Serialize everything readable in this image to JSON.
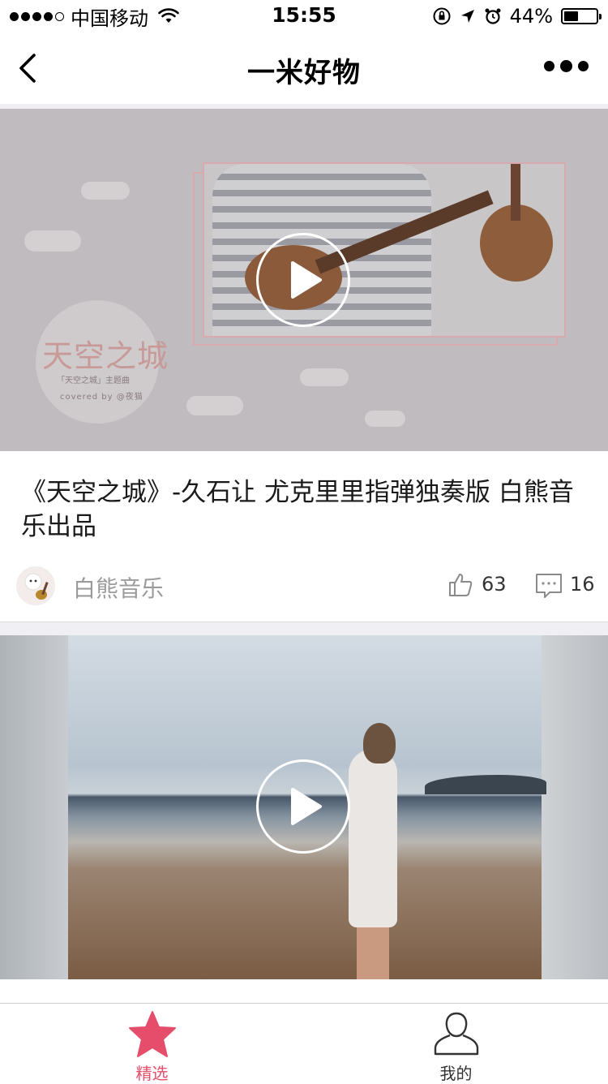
{
  "status_bar": {
    "carrier": "中国移动",
    "time": "15:55",
    "battery": "44%",
    "battery_level": 0.44
  },
  "nav": {
    "title": "一米好物",
    "back_icon": "chevron-left-icon",
    "more_icon": "more-dots-icon"
  },
  "feed": [
    {
      "title": "《天空之城》-久石让 尤克里里指弹独奏版 白熊音乐出品",
      "thumbnail_text": {
        "logo_title": "天空之城",
        "logo_sub": "「天空之城」主题曲",
        "logo_credit": "covered by @夜猫"
      },
      "author": "白熊音乐",
      "likes": "63",
      "comments": "16"
    },
    {
      "title": "",
      "author": ""
    }
  ],
  "tabs": [
    {
      "label": "精选",
      "icon": "star-icon",
      "active": true
    },
    {
      "label": "我的",
      "icon": "person-icon",
      "active": false
    }
  ],
  "colors": {
    "accent": "#e54d6b",
    "separator": "#efeff4",
    "muted_text": "#9b9b9b"
  }
}
